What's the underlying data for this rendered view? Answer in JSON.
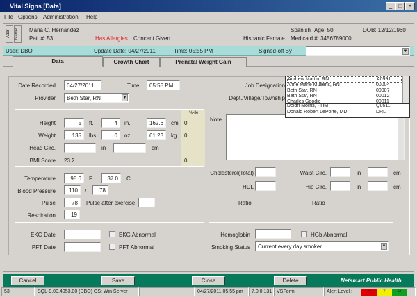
{
  "window": {
    "title": "Vital Signs [Data]",
    "min": "_",
    "max": "□",
    "close": "×"
  },
  "menu": [
    "File",
    "Options",
    "Administration",
    "Help"
  ],
  "patient": {
    "tab_addr": "Addr",
    "tab_name": "Name",
    "name": "Maria C. Hernandez",
    "pat_no": "Pat. #:  53",
    "allergies": "Has Allergies",
    "consent": "Concent Given",
    "ethnicity": "Hispanic",
    "sex": "Female",
    "language": "Spanish",
    "age": "Age: 50",
    "dob": "DOB: 12/12/1960",
    "medicaid": "Medicaid #:  3456789000"
  },
  "userbar": {
    "user": "User:  DBO",
    "update_date": "Update Date:  04/27/2011",
    "time": "Time:  05:55 PM",
    "signed_off": "Signed-off By"
  },
  "tabs": [
    "Data",
    "Growth Chart",
    "Prenatal Weight Gain"
  ],
  "signoff_list": [
    [
      "Andrew Martin, RN",
      "A0991"
    ],
    [
      "Anne Marie Mullens, RN",
      "00004"
    ],
    [
      "Beth Star, RN",
      "00007"
    ],
    [
      "Beth Star, RN",
      "00012"
    ],
    [
      "Charles Goodie",
      "00011"
    ],
    [
      "Deidri Morris, PHM",
      "Q0611"
    ],
    [
      "Donald Robert LePorte, MD",
      "DRL"
    ]
  ],
  "form": {
    "date_recorded_label": "Date Recorded",
    "date_recorded": "04/27/2011",
    "time_label": "Time",
    "time": "05:55 PM",
    "provider_label": "Provider",
    "provider": "Beth Star, RN",
    "job_label": "Job Designation",
    "dept_label": "Dept./Village/Township",
    "pctile_label": "%-ile",
    "height_label": "Height",
    "height_ft": "5",
    "ft": "ft.",
    "height_in": "4",
    "in_unit": "in.",
    "height_cm": "162.6",
    "cm": "cm",
    "height_pct": "0",
    "weight_label": "Weight",
    "weight_lbs": "135",
    "lbs": "lbs.",
    "weight_oz": "0",
    "oz": "oz.",
    "weight_kg": "61.23",
    "kg": "kg",
    "weight_pct": "0",
    "head_label": "Head Circ.",
    "in": "in",
    "cm2": "cm",
    "bmi_label": "BMI Score",
    "bmi": "23.2",
    "bmi_pct": "0",
    "temp_label": "Temperature",
    "temp_f": "98.6",
    "f": "F",
    "temp_c": "37.0",
    "c": "C",
    "bp_label": "Blood Pressure",
    "bp_sys": "110",
    "slash": "/",
    "bp_dia": "78",
    "pulse_label": "Pulse",
    "pulse": "78",
    "pulse_after_label": "Pulse after exercise",
    "resp_label": "Respiration",
    "resp": "19",
    "ekg_label": "EKG Date",
    "ekg_abn": "EKG Abnormal",
    "pft_label": "PFT Date",
    "pft_abn": "PFT Abnormal",
    "note_label": "Note",
    "chol_label": "Cholesterol(Total)",
    "hdl_label": "HDL",
    "waist_label": "Waist Circ.",
    "hip_label": "Hip Circ.",
    "cm3": "cm",
    "ratio": "Ratio",
    "hgb_label": "Hemoglobin",
    "hgb_abn": "HGb Abnormal",
    "smoking_label": "Smoking Status",
    "smoking": "Current every day smoker"
  },
  "buttons": {
    "cancel": "Cancel",
    "save": "Save",
    "close": "Close",
    "delete": "Delete",
    "brand": "Netsmart Public Health"
  },
  "status": {
    "id": "53",
    "sql": "SQL-9.00.4053.00 (DBO) OS: Win Server",
    "datetime": "04/27/2011 05:55 pm",
    "version": "7.0.0.131",
    "form": "VSForm",
    "alert": "Alert Level :",
    "r": "R",
    "y": "Y",
    "g": "G"
  },
  "colors": {
    "alert_r": "#e00000",
    "alert_y": "#f0f000",
    "alert_g": "#10a020",
    "allergy": "#e02020"
  }
}
